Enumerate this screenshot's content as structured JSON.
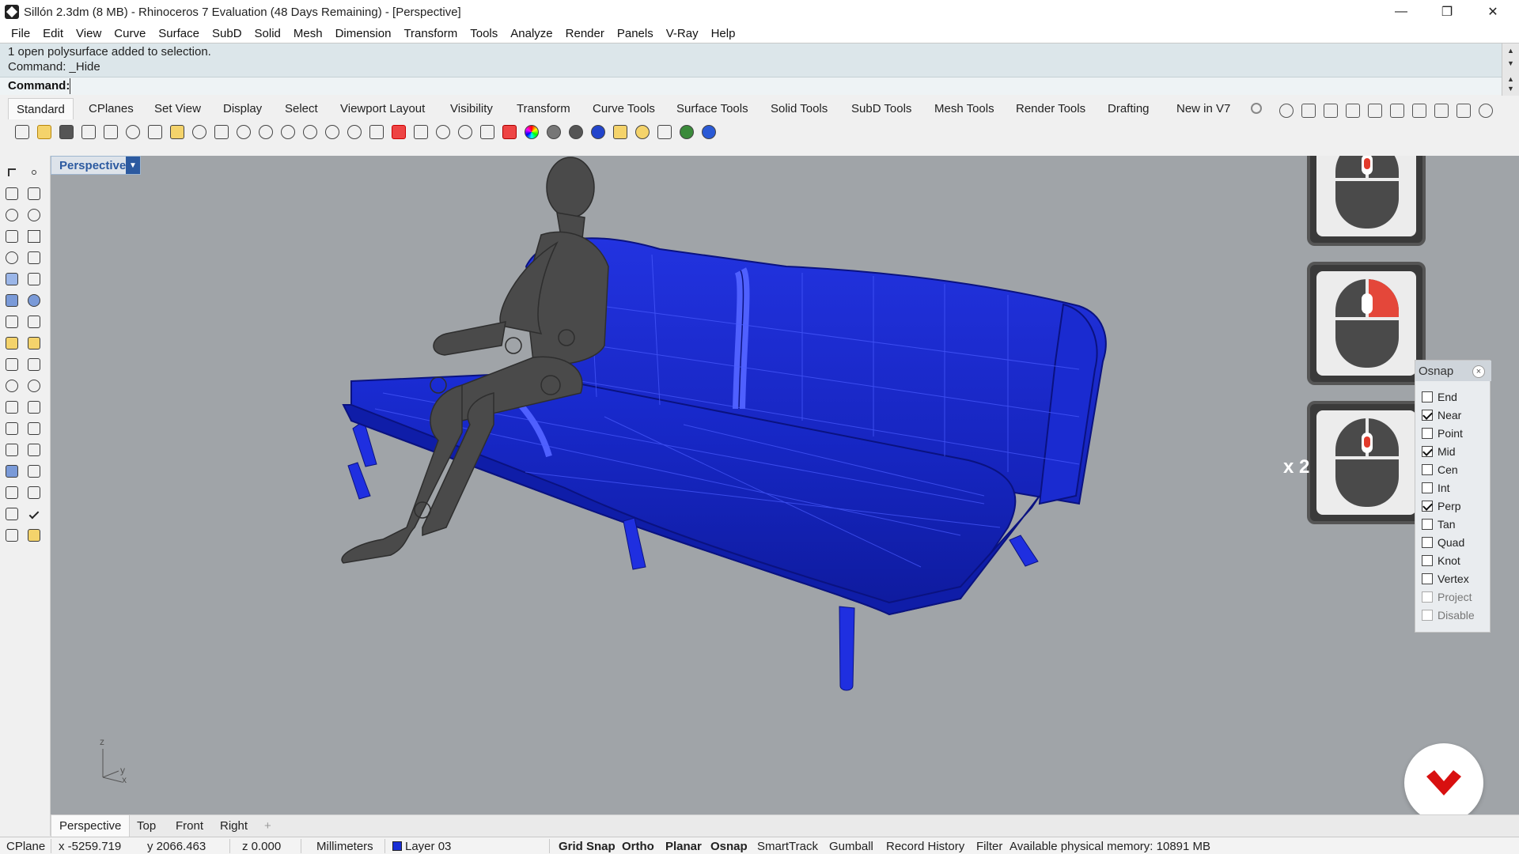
{
  "window": {
    "title": "Sillón 2.3dm (8 MB) - Rhinoceros 7 Evaluation (48 Days Remaining) - [Perspective]",
    "minimize": "—",
    "restore": "❐",
    "close": "✕"
  },
  "menu": [
    "File",
    "Edit",
    "View",
    "Curve",
    "Surface",
    "SubD",
    "Solid",
    "Mesh",
    "Dimension",
    "Transform",
    "Tools",
    "Analyze",
    "Render",
    "Panels",
    "V-Ray",
    "Help"
  ],
  "command": {
    "history": [
      "1 open polysurface added to selection.",
      "Command: _Hide"
    ],
    "prompt": "Command:",
    "value": ""
  },
  "toolbar_tabs": [
    "Standard",
    "CPlanes",
    "Set View",
    "Display",
    "Select",
    "Viewport Layout",
    "Visibility",
    "Transform",
    "Curve Tools",
    "Surface Tools",
    "Solid Tools",
    "SubD Tools",
    "Mesh Tools",
    "Render Tools",
    "Drafting",
    "New in V7"
  ],
  "toolbar_icons": [
    "new-icon",
    "open-icon",
    "save-icon",
    "print-icon",
    "export-icon",
    "cut-icon",
    "copy-icon",
    "paste-icon",
    "undo-icon",
    "pan-icon",
    "rotate-view-icon",
    "zoom-in-icon",
    "zoom-window-icon",
    "zoom-extents-icon",
    "zoom-selected-icon",
    "rotate-icon",
    "grid-icon",
    "car-icon",
    "hide-icon",
    "show-icon",
    "light-icon",
    "lock-icon",
    "material-icon",
    "color-wheel-icon",
    "sphere-icon",
    "render-sphere-icon",
    "blue-sphere-icon",
    "filter-icon",
    "settings-icon",
    "move-icon",
    "globe-icon",
    "help-icon"
  ],
  "right_icons": [
    "object-properties-icon",
    "box-icon",
    "cylinder-icon",
    "sphere-solid-icon",
    "cone-icon",
    "mesh-icon",
    "sub-icon",
    "leaf-icon",
    "hand-icon",
    "gear-small-icon"
  ],
  "viewport": {
    "label": "Perspective",
    "axes": {
      "z": "z",
      "y": "y",
      "x": "x"
    }
  },
  "mouse_panels": {
    "multiplier": "x 2"
  },
  "osnap": {
    "title": "Osnap",
    "items": [
      {
        "label": "End",
        "checked": false,
        "dim": false
      },
      {
        "label": "Near",
        "checked": true,
        "dim": false
      },
      {
        "label": "Point",
        "checked": false,
        "dim": false
      },
      {
        "label": "Mid",
        "checked": true,
        "dim": false
      },
      {
        "label": "Cen",
        "checked": false,
        "dim": false
      },
      {
        "label": "Int",
        "checked": false,
        "dim": false
      },
      {
        "label": "Perp",
        "checked": true,
        "dim": false
      },
      {
        "label": "Tan",
        "checked": false,
        "dim": false
      },
      {
        "label": "Quad",
        "checked": false,
        "dim": false
      },
      {
        "label": "Knot",
        "checked": false,
        "dim": false
      },
      {
        "label": "Vertex",
        "checked": false,
        "dim": false
      },
      {
        "label": "Project",
        "checked": false,
        "dim": true
      },
      {
        "label": "Disable",
        "checked": false,
        "dim": true
      }
    ]
  },
  "viewport_tabs": [
    "Perspective",
    "Top",
    "Front",
    "Right",
    "+"
  ],
  "status": {
    "cplane": "CPlane",
    "x": "x -5259.719",
    "y": "y 2066.463",
    "z": "z 0.000",
    "units": "Millimeters",
    "layer": "Layer 03",
    "layer_color": "#1a2fd6",
    "grid_snap": "Grid Snap",
    "ortho": "Ortho",
    "planar": "Planar",
    "osnap": "Osnap",
    "smarttrack": "SmartTrack",
    "gumball": "Gumball",
    "record_history": "Record History",
    "filter": "Filter",
    "memory": "Available physical memory: 10891 MB"
  },
  "colors": {
    "model_blue": "#1f2fe0",
    "viewport_bg": "#a0a4a8",
    "figure_gray": "#4a4a4a"
  }
}
